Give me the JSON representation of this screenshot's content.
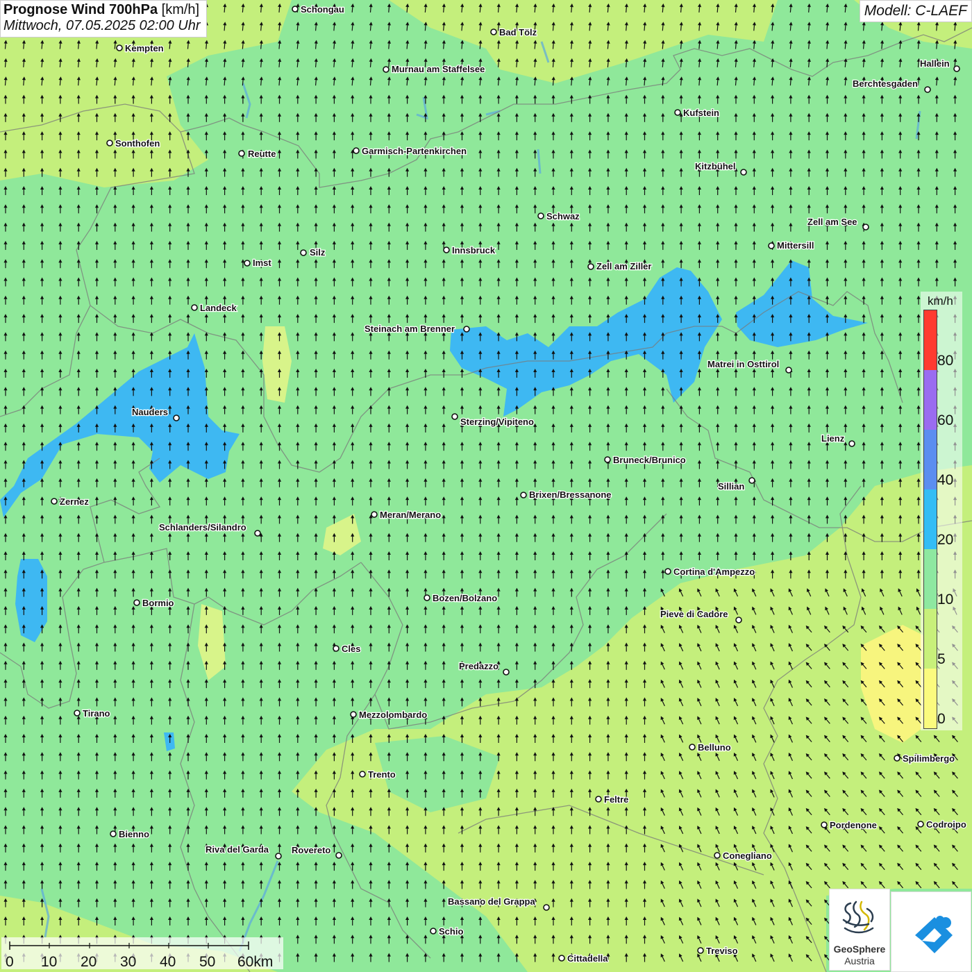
{
  "header": {
    "title": "Prognose Wind 700hPa",
    "unit": "[km/h]",
    "datetime": "Mittwoch, 07.05.2025 02:00 Uhr",
    "model": "Modell: C-LAEF"
  },
  "legend": {
    "unit": "km/h",
    "ticks": [
      "80",
      "60",
      "40",
      "20",
      "10",
      "5",
      "0"
    ],
    "colors": [
      "#ff3b30",
      "#9a6cf0",
      "#5b8ef0",
      "#33bdf5",
      "#8ee8a0",
      "#c8f07a",
      "#fbfb7e"
    ]
  },
  "colors": {
    "base_green": "#8fe89a",
    "light_green": "#c4ef7c",
    "yellow": "#f7f57e",
    "blue": "#3eb8f2",
    "border_line": "#7a7a7a",
    "water": "#8ad0f0"
  },
  "scale_bar": {
    "labels": [
      "0",
      "10",
      "20",
      "30",
      "40",
      "50",
      "60km"
    ]
  },
  "cities": [
    {
      "name": "Schongau"
    },
    {
      "name": "Bad Tölz"
    },
    {
      "name": "Kempten"
    },
    {
      "name": "Murnau am Staffelsee"
    },
    {
      "name": "Hallein"
    },
    {
      "name": "Berchtesgaden"
    },
    {
      "name": "Kufstein"
    },
    {
      "name": "Sonthofen"
    },
    {
      "name": "Reutte"
    },
    {
      "name": "Garmisch-Partenkirchen"
    },
    {
      "name": "Kitzbühel"
    },
    {
      "name": "Schwaz"
    },
    {
      "name": "Zell am See"
    },
    {
      "name": "Mittersill"
    },
    {
      "name": "Innsbruck"
    },
    {
      "name": "Silz"
    },
    {
      "name": "Imst"
    },
    {
      "name": "Zell am Ziller"
    },
    {
      "name": "Landeck"
    },
    {
      "name": "Steinach am Brenner"
    },
    {
      "name": "Matrei in Osttirol"
    },
    {
      "name": "Nauders"
    },
    {
      "name": "Sterzing/Vipiteno"
    },
    {
      "name": "Lienz"
    },
    {
      "name": "Bruneck/Brunico"
    },
    {
      "name": "Sillian"
    },
    {
      "name": "Zernez"
    },
    {
      "name": "Brixen/Bressanone"
    },
    {
      "name": "Meran/Merano"
    },
    {
      "name": "Schlanders/Silandro"
    },
    {
      "name": "Cortina d'Ampezzo"
    },
    {
      "name": "Bozen/Bolzano"
    },
    {
      "name": "Bormio"
    },
    {
      "name": "Pieve di Cadore"
    },
    {
      "name": "Cles"
    },
    {
      "name": "Predazzo"
    },
    {
      "name": "Tirano"
    },
    {
      "name": "Mezzolombardo"
    },
    {
      "name": "Belluno"
    },
    {
      "name": "Spilimbergo"
    },
    {
      "name": "Trento"
    },
    {
      "name": "Feltre"
    },
    {
      "name": "Pordenone"
    },
    {
      "name": "Codroipo"
    },
    {
      "name": "Bienno"
    },
    {
      "name": "Riva del Garda"
    },
    {
      "name": "Rovereto"
    },
    {
      "name": "Conegliano"
    },
    {
      "name": "Bassano del Grappa"
    },
    {
      "name": "Schio"
    },
    {
      "name": "Treviso"
    },
    {
      "name": "Cittadella"
    }
  ],
  "logo": {
    "line1": "GeoSphere",
    "line2": "Austria"
  }
}
